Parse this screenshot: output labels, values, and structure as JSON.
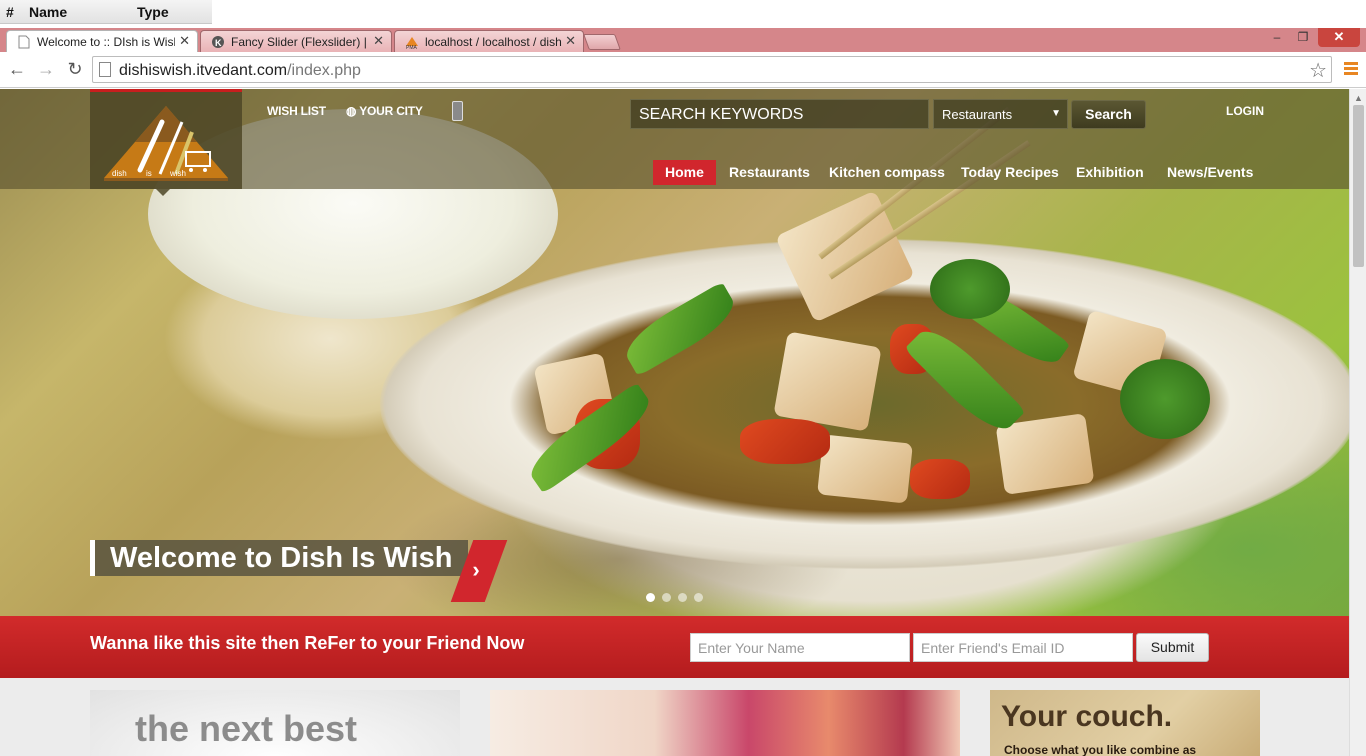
{
  "table_header": {
    "col_hash": "#",
    "col_name": "Name",
    "col_type": "Type"
  },
  "browser": {
    "tabs": [
      {
        "label": "Welcome to :: DIsh is Wish",
        "active": true
      },
      {
        "label": "Fancy Slider (Flexslider) | K",
        "active": false
      },
      {
        "label": "localhost / localhost / dish",
        "active": false
      }
    ],
    "window_buttons": {
      "minimize": "‒",
      "maximize": "❐",
      "close": "✕"
    },
    "url_host": "dishiswish.itvedant.com",
    "url_path": "/index.php"
  },
  "site": {
    "logo": {
      "word1": "dish",
      "word2": "is",
      "word3": "wish"
    },
    "top_links": {
      "wishlist": "WISH LIST",
      "your_city": "YOUR CITY",
      "login": "LOGIN"
    },
    "search": {
      "placeholder": "SEARCH KEYWORDS",
      "category": "Restaurants",
      "button": "Search"
    },
    "nav": [
      "Home",
      "Restaurants",
      "Kitchen compass",
      "Today Recipes",
      "Exhibition",
      "News/Events"
    ],
    "slider": {
      "caption": "Welcome to Dish Is Wish",
      "slides": 4,
      "current": 1
    },
    "refer": {
      "text": "Wanna like this site then ReFer to your Friend Now",
      "name_placeholder": "Enter Your Name",
      "email_placeholder": "Enter Friend's Email ID",
      "submit": "Submit"
    },
    "promo": {
      "card1_text": "the next best",
      "card3_title": "Your couch.",
      "card3_sub": "Choose what you like combine as"
    }
  },
  "colors": {
    "accent_red": "#d1262d",
    "tab_strip": "#d5868a",
    "menu_icon": "#e88622"
  }
}
